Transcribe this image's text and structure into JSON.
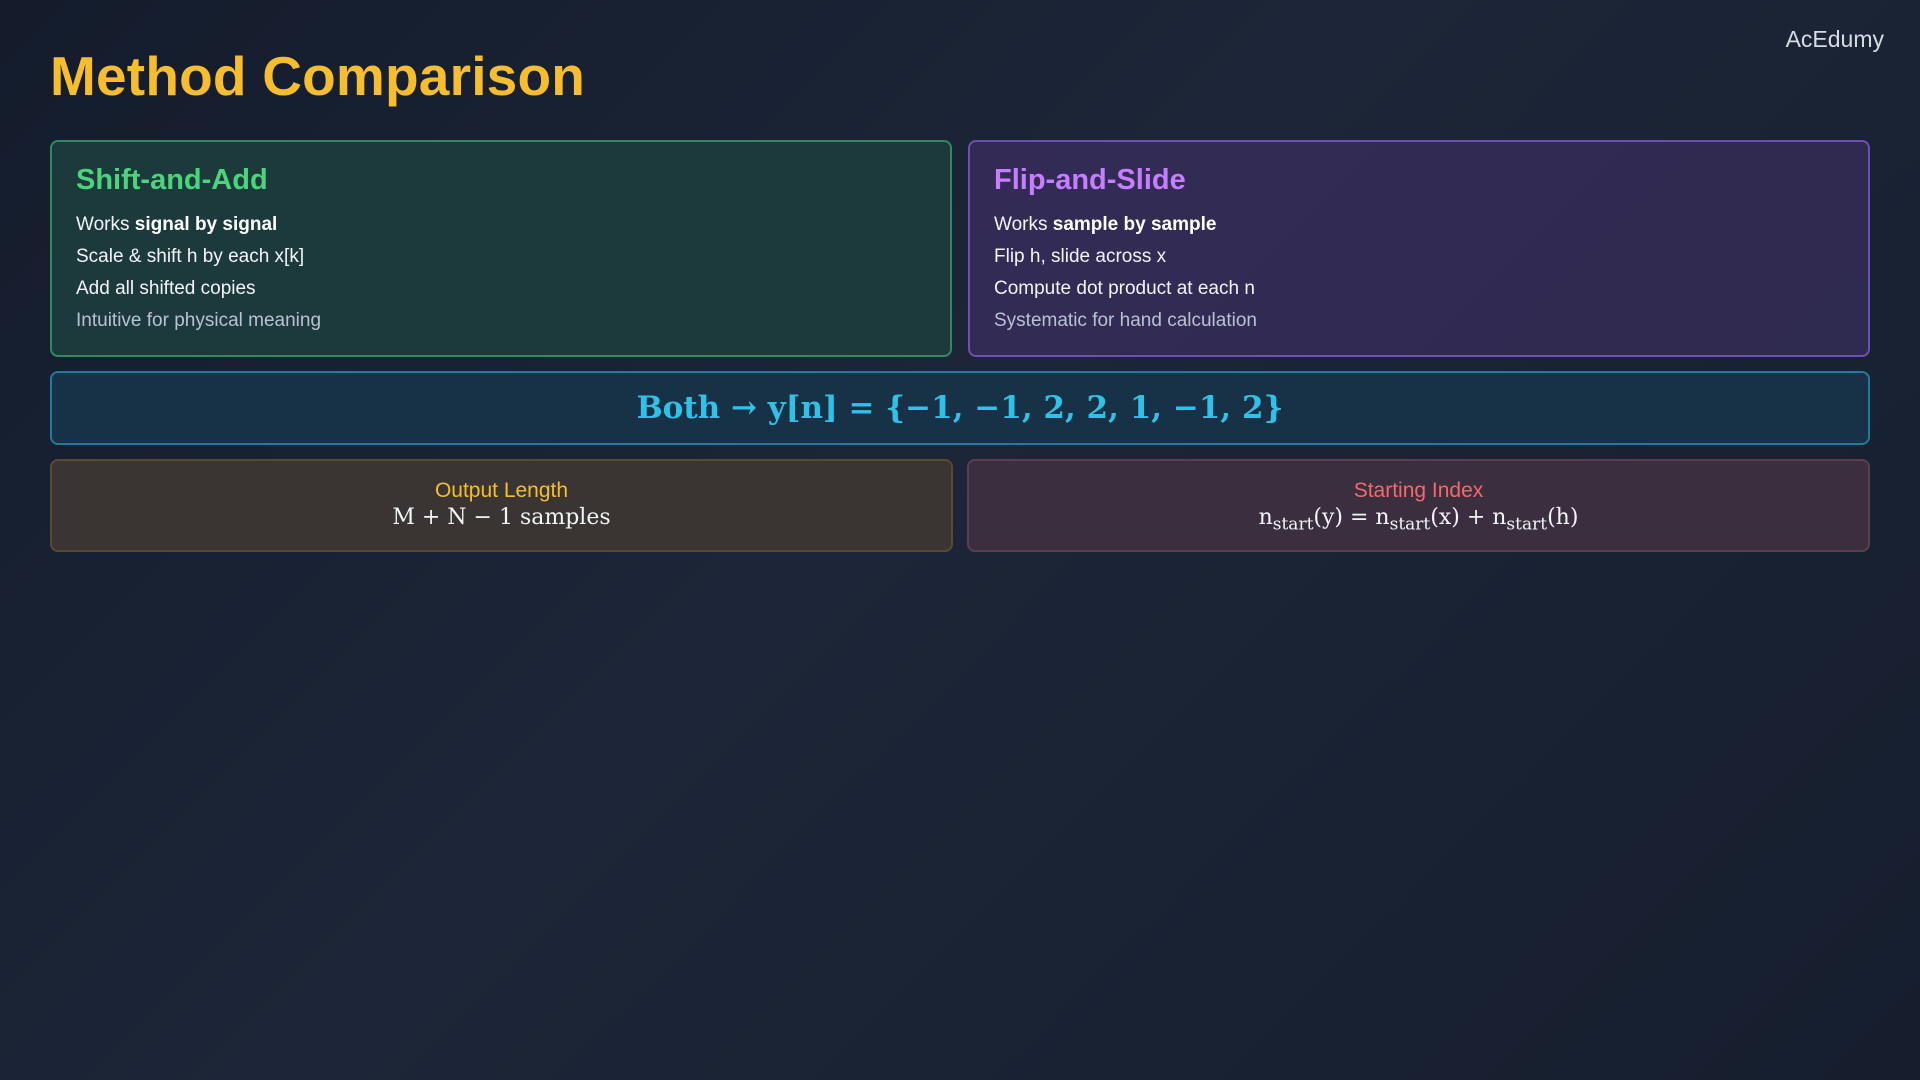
{
  "brand": "AcEdumy",
  "title": "Method Comparison",
  "cards": [
    {
      "title": "Shift-and-Add",
      "line1_prefix": "Works ",
      "line1_bold": "signal by signal",
      "line2": "Scale & shift h by each x[k]",
      "line3": "Add all shifted copies",
      "line4": "Intuitive for physical meaning",
      "accent": "#4ad47c"
    },
    {
      "title": "Flip-and-Slide",
      "line1_prefix": "Works ",
      "line1_bold": "sample by sample",
      "line2": "Flip h, slide across x",
      "line3": "Compute dot product at each n",
      "line4": "Systematic for hand calculation",
      "accent": "#c77dff"
    }
  ],
  "banner": {
    "text": "Both → y[n] = {−1, −1, 2, 2, 1, −1, 2}",
    "color": "#2fc2e8"
  },
  "output_length": {
    "label": "Output Length",
    "formula": "M + N − 1 samples",
    "color": "#f6bd2f"
  },
  "starting_index": {
    "label": "Starting Index",
    "n1": "n",
    "sub1": "start",
    "arg1": "(y) = ",
    "n2": "n",
    "sub2": "start",
    "arg2": "(x) + ",
    "n3": "n",
    "sub3": "start",
    "arg3": "(h)",
    "color": "#f26a6a"
  }
}
